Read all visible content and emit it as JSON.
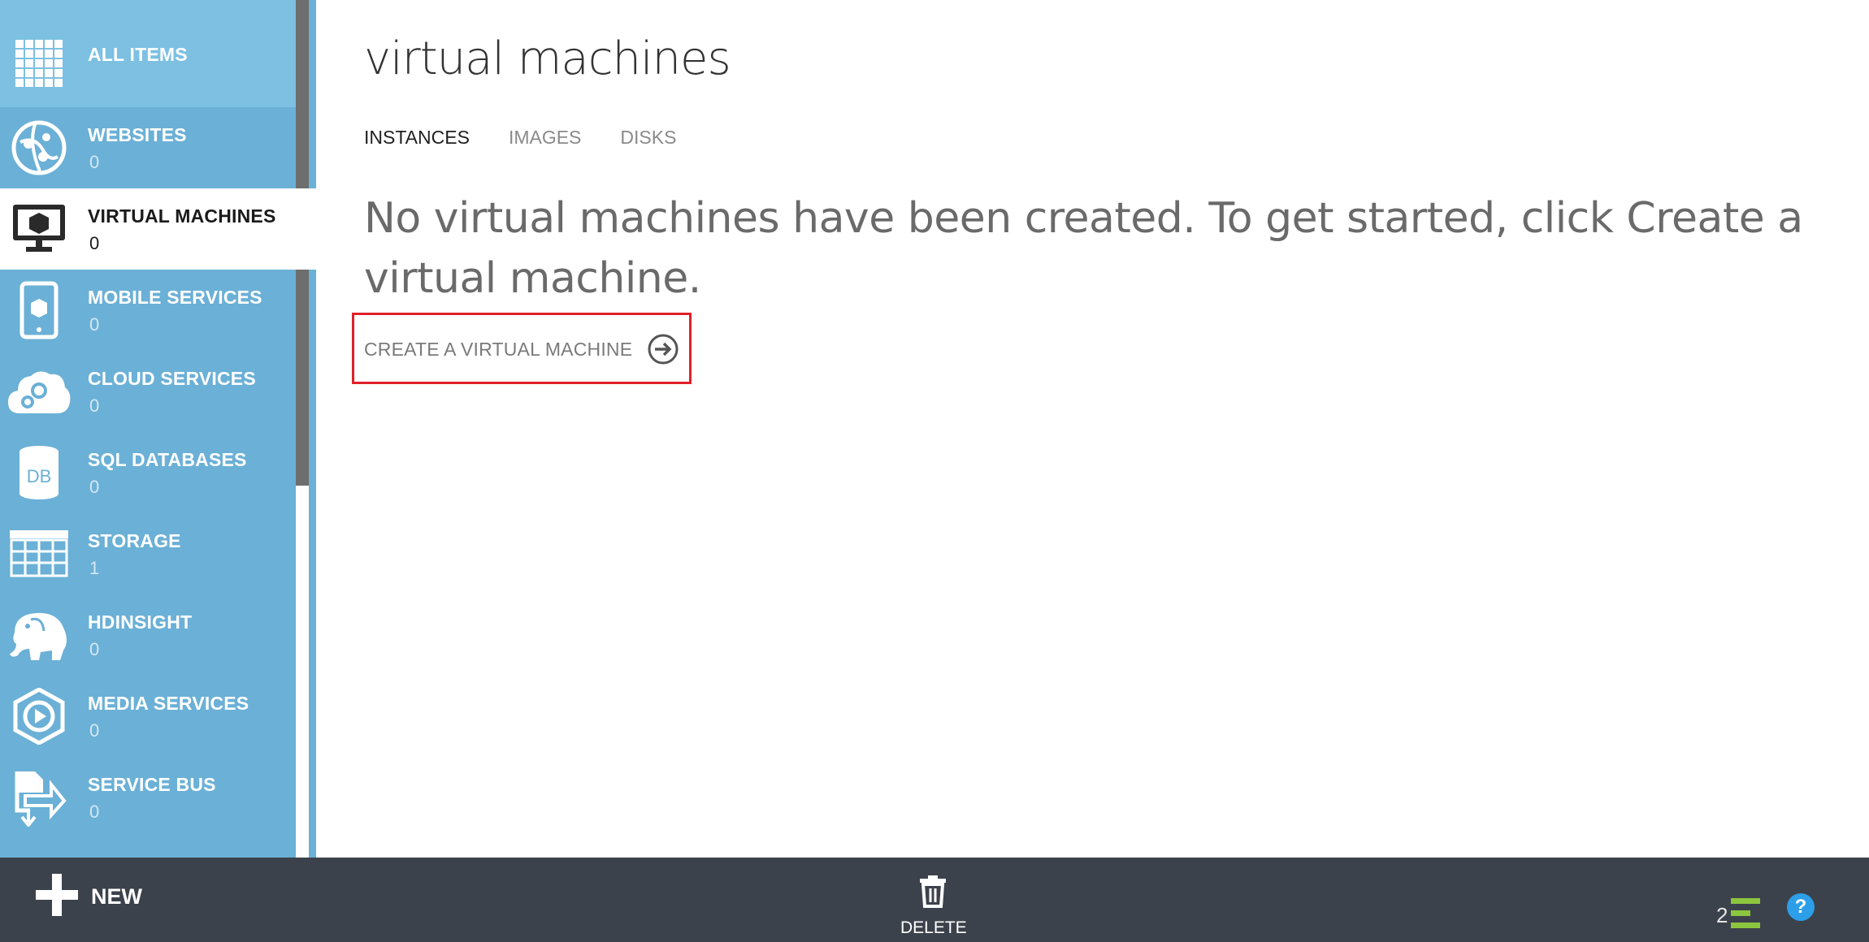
{
  "sidebar": {
    "items": [
      {
        "label": "ALL ITEMS",
        "count": "",
        "icon": "grid-icon"
      },
      {
        "label": "WEBSITES",
        "count": "0",
        "icon": "globe-icon"
      },
      {
        "label": "VIRTUAL MACHINES",
        "count": "0",
        "icon": "monitor-icon"
      },
      {
        "label": "MOBILE SERVICES",
        "count": "0",
        "icon": "mobile-icon"
      },
      {
        "label": "CLOUD SERVICES",
        "count": "0",
        "icon": "cloud-gear-icon"
      },
      {
        "label": "SQL DATABASES",
        "count": "0",
        "icon": "database-icon"
      },
      {
        "label": "STORAGE",
        "count": "1",
        "icon": "table-icon"
      },
      {
        "label": "HDINSIGHT",
        "count": "0",
        "icon": "elephant-icon"
      },
      {
        "label": "MEDIA SERVICES",
        "count": "0",
        "icon": "play-icon"
      },
      {
        "label": "SERVICE BUS",
        "count": "0",
        "icon": "service-bus-icon"
      }
    ]
  },
  "main": {
    "title": "virtual machines",
    "tabs": [
      {
        "label": "INSTANCES"
      },
      {
        "label": "IMAGES"
      },
      {
        "label": "DISKS"
      }
    ],
    "empty_message": "No virtual machines have been created. To get started, click Create a virtual machine.",
    "create_link": "CREATE A VIRTUAL MACHINE"
  },
  "bottombar": {
    "new_label": "NEW",
    "delete_label": "DELETE",
    "notification_count": "2",
    "help_label": "?"
  },
  "colors": {
    "sidebar": "#6bb0d6",
    "accent": "#2d9ee8",
    "bottombar": "#3c424b",
    "highlight": "#e0202a"
  }
}
